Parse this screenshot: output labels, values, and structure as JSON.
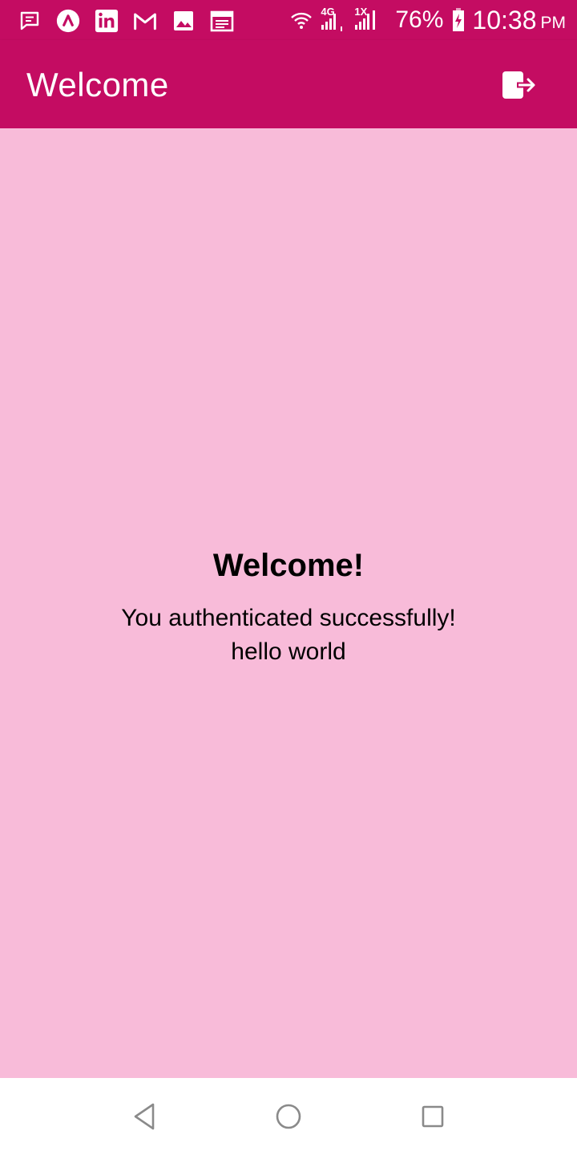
{
  "colors": {
    "primary": "#c40c62",
    "background": "#f8bbd9",
    "nav_bar": "#ffffff",
    "nav_icon": "#8a8a8a"
  },
  "status_bar": {
    "left_icons": [
      "message-icon",
      "arc-app-icon",
      "linkedin-icon",
      "gmail-icon",
      "gallery-icon",
      "calendar-icon"
    ],
    "sim1_network": "4G",
    "sim2_network": "1X",
    "sim1_slot": "1",
    "sim2_slot": "2",
    "battery_percent": "76%",
    "time": "10:38",
    "ampm": "PM"
  },
  "app_bar": {
    "title": "Welcome",
    "action_icon": "logout-icon"
  },
  "main": {
    "headline": "Welcome!",
    "message_line1": "You authenticated successfully!",
    "message_line2": "hello world"
  },
  "nav_bar": {
    "buttons": [
      "back-icon",
      "home-icon",
      "recents-icon"
    ]
  }
}
